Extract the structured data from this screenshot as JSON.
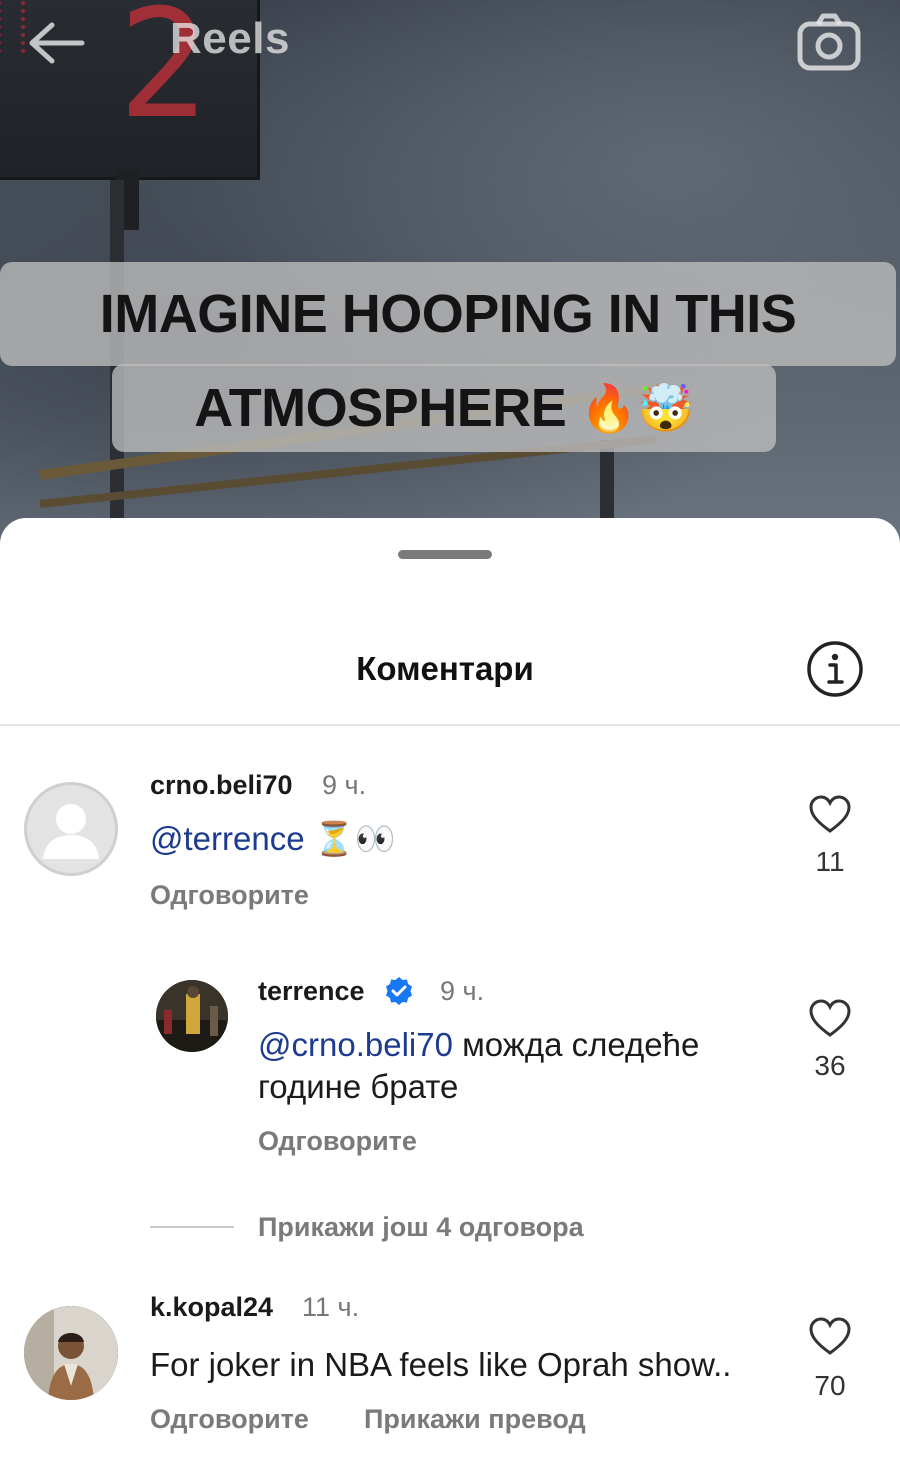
{
  "topbar": {
    "title": "Reels",
    "back_icon": "arrow-left-icon",
    "camera_icon": "camera-icon"
  },
  "video": {
    "shot_clock_value": "2",
    "caption_line_1": "IMAGINE HOOPING IN THIS",
    "caption_line_2": "ATMOSPHERE",
    "caption_emojis": "🔥🤯"
  },
  "sheet": {
    "title": "Коментари",
    "info_icon": "info-icon"
  },
  "comments": [
    {
      "username": "crno.beli70",
      "time": "9 ч.",
      "mention": "@terrence",
      "text": " ⏳👀",
      "reply_label": "Одговорите",
      "likes": "11"
    },
    {
      "username": "terrence",
      "verified": true,
      "time": "9 ч.",
      "mention": "@crno.beli70",
      "text_line_1": " можда следеће",
      "text_line_2": "године брате",
      "reply_label": "Одговорите",
      "likes": "36"
    },
    {
      "username": "k.kopal24",
      "time": "11 ч.",
      "text": "For joker in NBA feels like Oprah show..",
      "reply_label": "Одговорите",
      "translate_label": "Прикажи превод",
      "likes": "70"
    }
  ],
  "more_replies_label": "Прикажи још 4 одговора",
  "colors": {
    "mention": "#1d3b8f",
    "verified": "#1877f2",
    "secondary_text": "#7a7a7a"
  }
}
